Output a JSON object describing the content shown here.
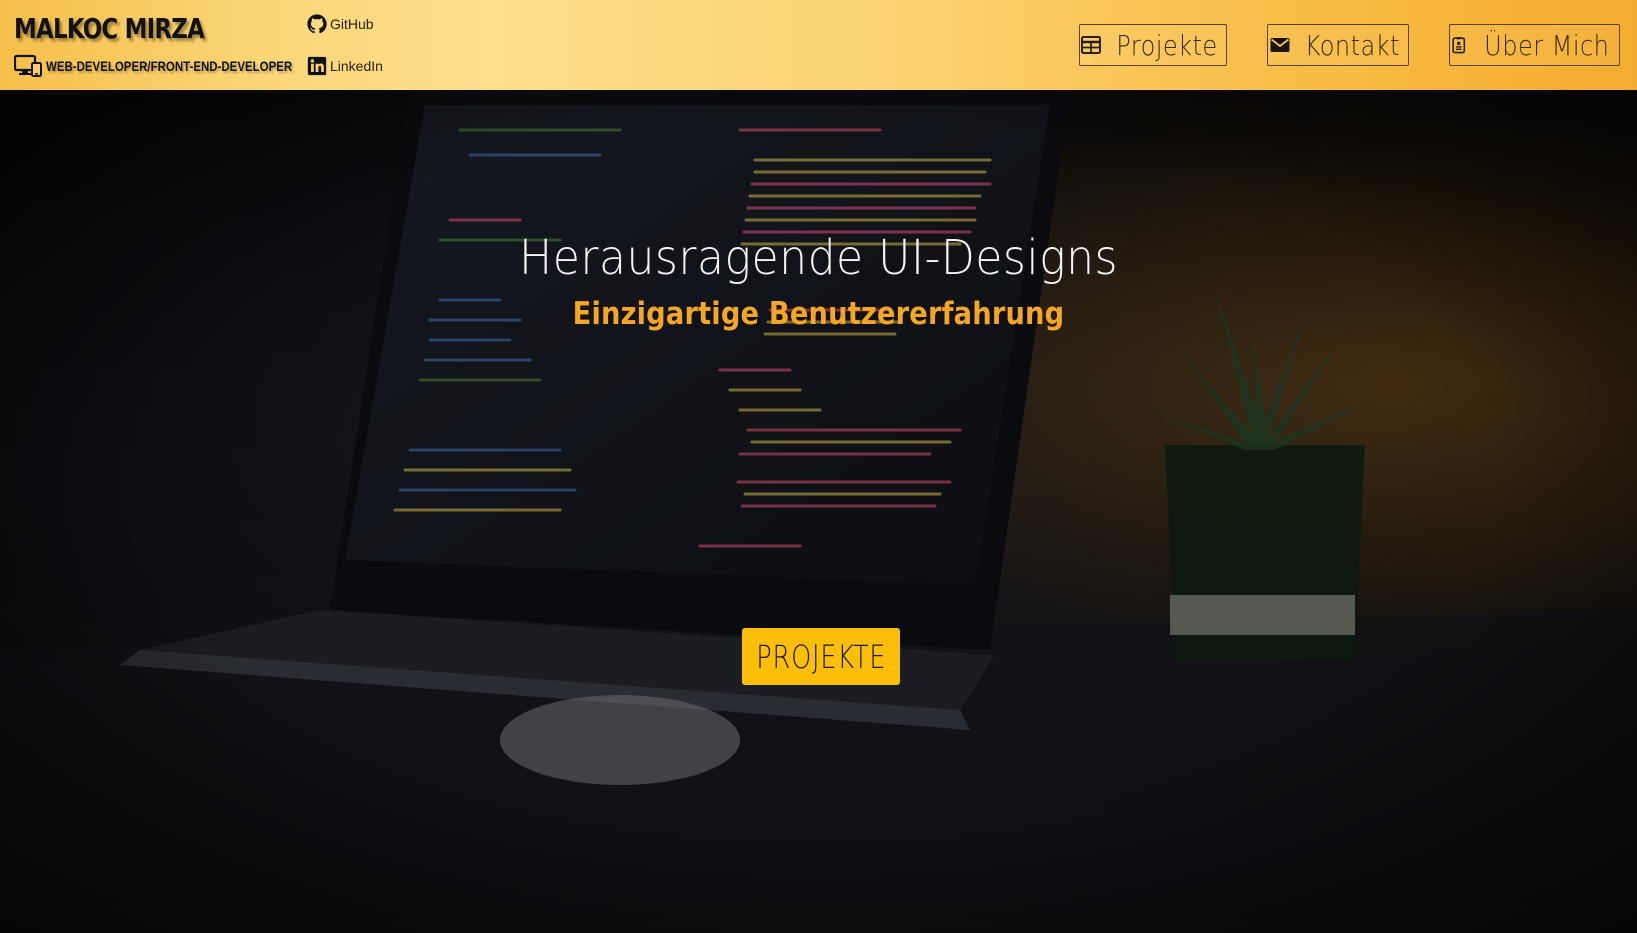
{
  "header": {
    "brand_name": "MALKOC MIRZA",
    "brand_role": "WEB-DEVELOPER/FRONT-END-DEVELOPER",
    "social": [
      {
        "label": "GitHub",
        "icon": "github-icon"
      },
      {
        "label": "LinkedIn",
        "icon": "linkedin-icon"
      }
    ],
    "nav": [
      {
        "label": "Projekte",
        "icon": "table-icon"
      },
      {
        "label": "Kontakt",
        "icon": "envelope-icon"
      },
      {
        "label": "Über Mich",
        "icon": "id-badge-icon"
      }
    ]
  },
  "hero": {
    "title": "Herausragende UI-Designs",
    "subtitle": "Einzigartige Benutzererfahrung",
    "cta_label": "PROJEKTE"
  },
  "colors": {
    "header_gradient_start": "#f6bf4a",
    "header_gradient_end": "#f4ad2f",
    "accent": "#f5a623",
    "cta_background": "#fbbf0a",
    "title_text": "#f4f4f4"
  }
}
